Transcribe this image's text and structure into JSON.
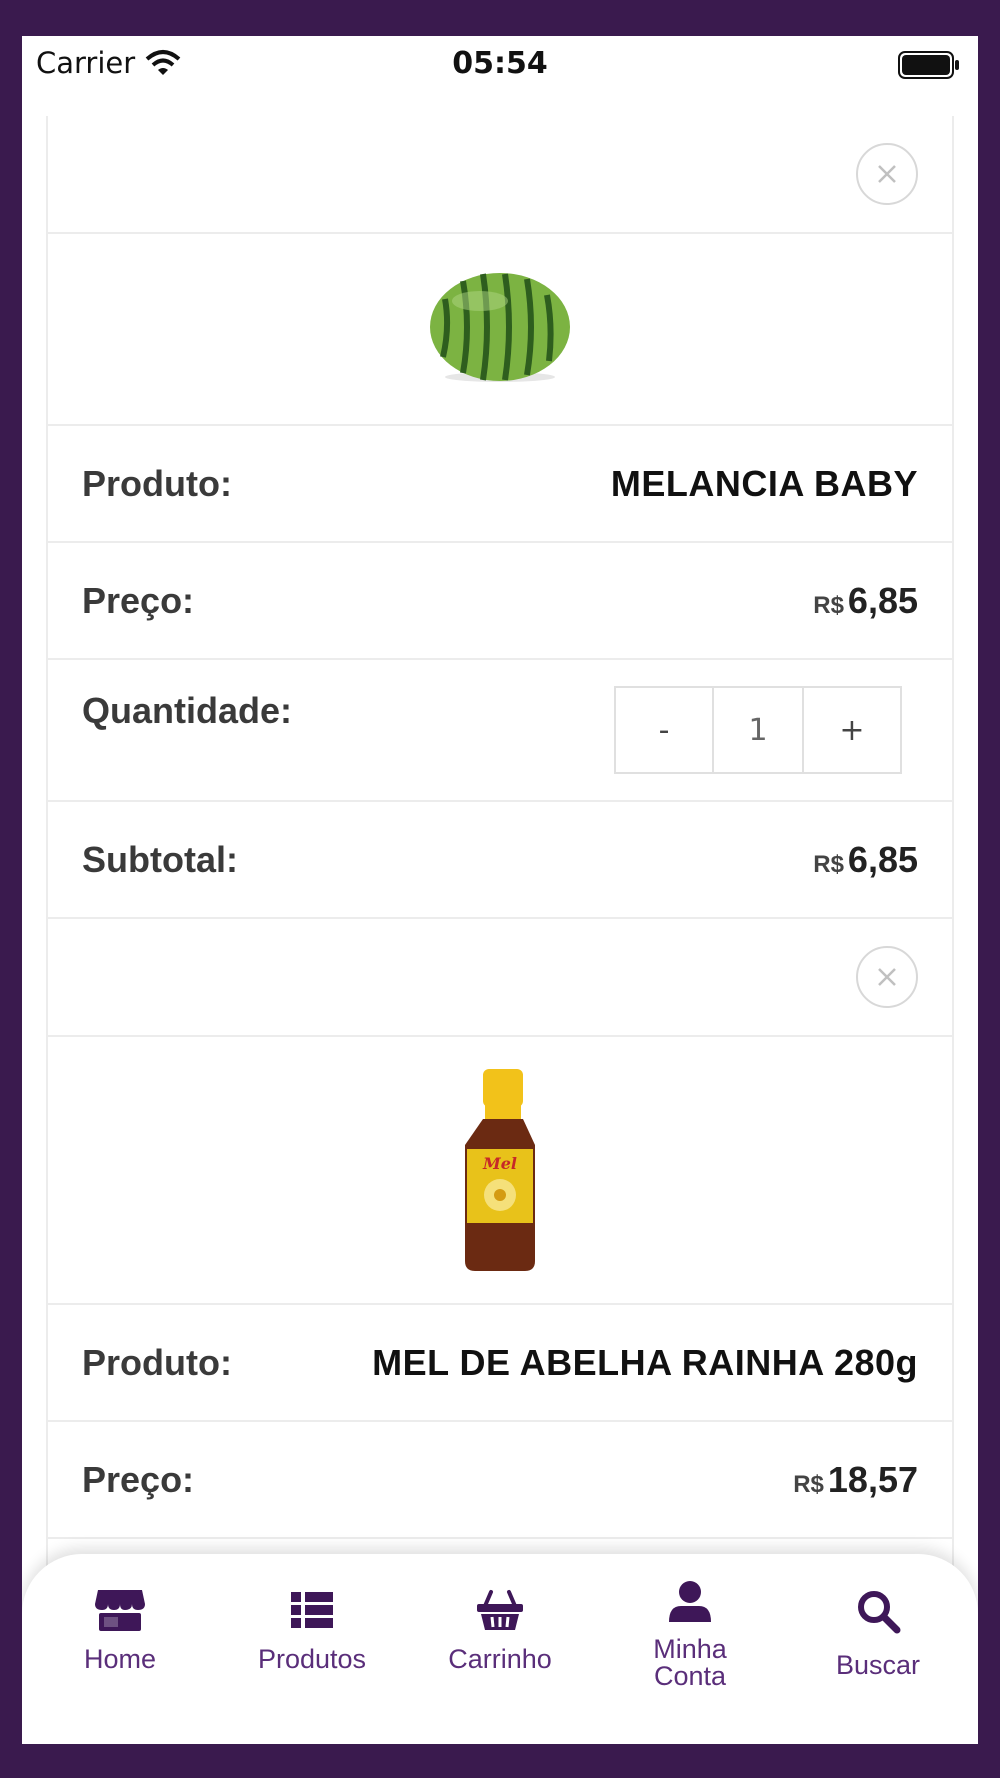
{
  "status_bar": {
    "carrier": "Carrier",
    "time": "05:54"
  },
  "cart_items": [
    {
      "image": "watermelon",
      "product_label": "Produto:",
      "product_name": "MELANCIA BABY",
      "price_label": "Preço:",
      "currency": "R$",
      "price": "6,85",
      "quantity_label": "Quantidade:",
      "quantity": "1",
      "decrement": "-",
      "increment": "+",
      "subtotal_label": "Subtotal:",
      "subtotal": "6,85"
    },
    {
      "image": "honey-bottle",
      "image_text": "Mel",
      "product_label": "Produto:",
      "product_name": "MEL DE ABELHA RAINHA 280g",
      "price_label": "Preço:",
      "currency": "R$",
      "price": "18,57"
    }
  ],
  "tabbar": {
    "items": [
      {
        "label": "Home",
        "icon": "store-icon"
      },
      {
        "label": "Produtos",
        "icon": "list-icon"
      },
      {
        "label": "Carrinho",
        "icon": "basket-icon"
      },
      {
        "label": "Minha\nConta",
        "icon": "user-icon"
      },
      {
        "label": "Buscar",
        "icon": "search-icon"
      }
    ]
  },
  "colors": {
    "frame": "#3a1a4e",
    "accent": "#5a2e7a"
  }
}
